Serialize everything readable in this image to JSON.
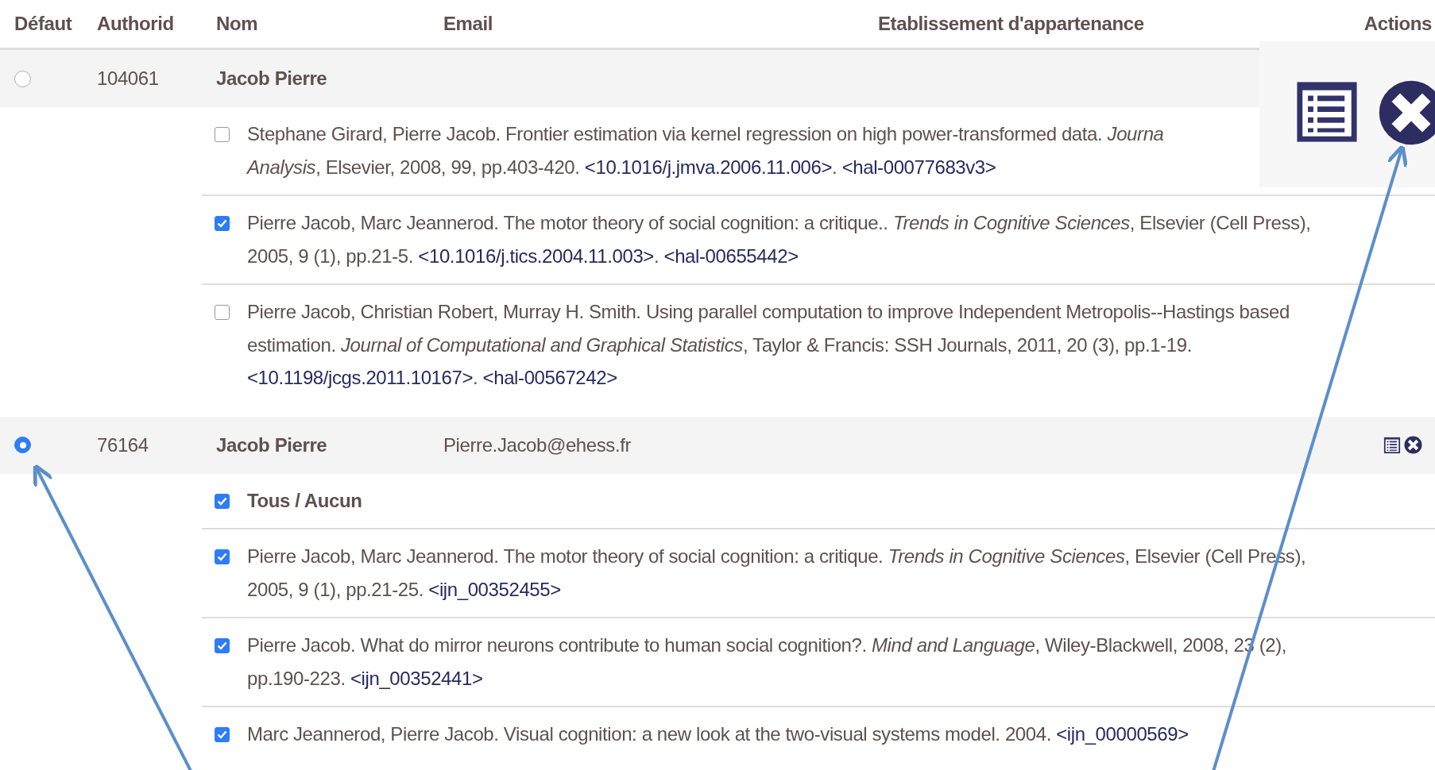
{
  "columns": [
    "Défaut",
    "Authorid",
    "Nom",
    "Email",
    "Etablissement d'appartenance",
    "Actions"
  ],
  "authors": [
    {
      "selected": false,
      "authorid": "104061",
      "name": "Jacob Pierre",
      "publications": [
        {
          "checked": false,
          "lines": [
            [
              {
                "kind": "text",
                "text": "Stephane Girard, Pierre Jacob. Frontier estimation via kernel regression on high power-transformed data. *Journa*"
              }
            ],
            [
              {
                "kind": "text",
                "text": "*Analysis*, Elsevier, 2008, 99, pp.403-420. "
              },
              {
                "kind": "link",
                "text": "<10.1016/j.jmva.2006.11.006>"
              },
              {
                "kind": "text",
                "text": ". "
              },
              {
                "kind": "link",
                "text": "<hal-00077683v3>"
              }
            ]
          ]
        },
        {
          "checked": true,
          "lines": [
            [
              {
                "kind": "text",
                "text": "Pierre Jacob, Marc Jeannerod. The motor theory of social cognition: a critique.. *Trends in Cognitive Sciences*, Elsevier (Cell Press),"
              }
            ],
            [
              {
                "kind": "text",
                "text": "2005, 9 (1), pp.21-5. "
              },
              {
                "kind": "link",
                "text": "<10.1016/j.tics.2004.11.003>"
              },
              {
                "kind": "text",
                "text": ". "
              },
              {
                "kind": "link",
                "text": "<hal-00655442>"
              }
            ]
          ]
        },
        {
          "checked": false,
          "lines": [
            [
              {
                "kind": "text",
                "text": "Pierre Jacob, Christian Robert, Murray H. Smith. Using parallel computation to improve Independent Metropolis--Hastings based"
              }
            ],
            [
              {
                "kind": "text",
                "text": "estimation. *Journal of Computational and Graphical Statistics*, Taylor & Francis: SSH Journals, 2011, 20 (3), pp.1-19."
              }
            ],
            [
              {
                "kind": "link",
                "text": "<10.1198/jcgs.2011.10167>"
              },
              {
                "kind": "text",
                "text": ". "
              },
              {
                "kind": "link",
                "text": "<hal-00567242>"
              }
            ]
          ]
        }
      ]
    },
    {
      "selected": true,
      "authorid": "76164",
      "name": "Jacob Pierre",
      "email": "Pierre.Jacob@ehess.fr",
      "select_all": {
        "label": "Tous / Aucun",
        "checked": true
      },
      "publications": [
        {
          "checked": true,
          "lines": [
            [
              {
                "kind": "text",
                "text": "Pierre Jacob, Marc Jeannerod. The motor theory of social cognition: a critique. *Trends in Cognitive Sciences*, Elsevier (Cell Press),"
              }
            ],
            [
              {
                "kind": "text",
                "text": "2005, 9 (1), pp.21-25. "
              },
              {
                "kind": "link",
                "text": "<ijn_00352455>"
              }
            ]
          ]
        },
        {
          "checked": true,
          "lines": [
            [
              {
                "kind": "text",
                "text": "Pierre Jacob. What do mirror neurons contribute to human social cognition?. *Mind and Language*, Wiley-Blackwell, 2008, 23 (2),"
              }
            ],
            [
              {
                "kind": "text",
                "text": "pp.190-223. "
              },
              {
                "kind": "link",
                "text": "<ijn_00352441>"
              }
            ]
          ]
        },
        {
          "checked": true,
          "lines": [
            [
              {
                "kind": "text",
                "text": "Marc Jeannerod, Pierre Jacob. Visual cognition: a new look at the two-visual systems model. 2004. "
              },
              {
                "kind": "link",
                "text": "<ijn_00000569>"
              }
            ]
          ]
        }
      ]
    }
  ]
}
